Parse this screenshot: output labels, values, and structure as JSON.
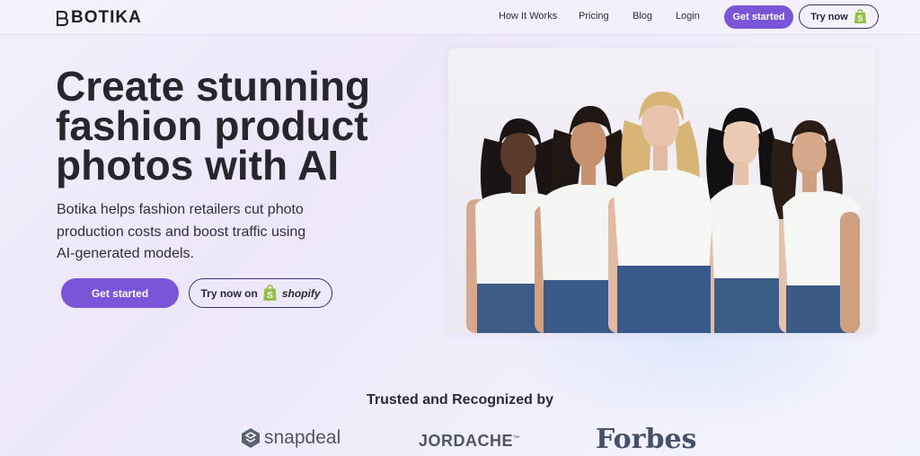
{
  "nav": {
    "logo_text": "BOTIKA",
    "links": [
      "How It Works",
      "Pricing",
      "Blog",
      "Login"
    ],
    "get_started": "Get started",
    "try_now": "Try now"
  },
  "hero": {
    "title": "Create stunning fashion product photos with AI",
    "subtitle": "Botika helps fashion retailers cut photo production costs and boost traffic using AI-generated models.",
    "primary_button": "Get started",
    "secondary_button": "Try now on",
    "secondary_brand": "shopify"
  },
  "trusted": {
    "title": "Trusted and Recognized by",
    "brands": [
      "snapdeal",
      "JORDACHE",
      "Forbes"
    ],
    "jordache_mark": "™"
  },
  "colors": {
    "accent": "#7b55d8",
    "outline": "#3a2f6b",
    "shopify_green": "#95bf47"
  },
  "icons": [
    "botika-logo-icon",
    "shopify-bag-icon",
    "snapdeal-logo-icon"
  ]
}
